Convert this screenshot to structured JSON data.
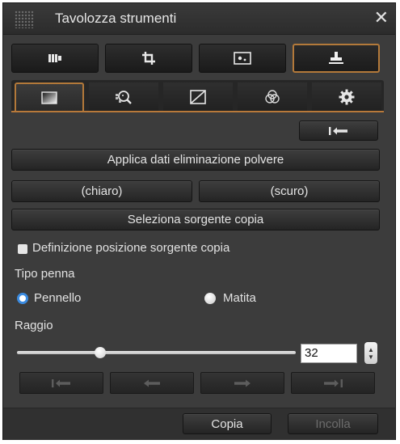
{
  "window": {
    "title": "Tavolozza strumenti"
  },
  "top_tabs": [
    {
      "name": "tab-adjust",
      "icon": "bars-icon",
      "active": false
    },
    {
      "name": "tab-crop",
      "icon": "crop-icon",
      "active": false
    },
    {
      "name": "tab-dust",
      "icon": "dust-icon",
      "active": false
    },
    {
      "name": "tab-stamp",
      "icon": "stamp-icon",
      "active": true
    }
  ],
  "sub_tabs": [
    {
      "icon": "gradient-icon",
      "active": true
    },
    {
      "icon": "magnify-grid-icon",
      "active": false
    },
    {
      "icon": "curve-icon",
      "active": false
    },
    {
      "icon": "color-circles-icon",
      "active": false
    },
    {
      "icon": "gear-icon",
      "active": false
    }
  ],
  "buttons": {
    "apply_dust": "Applica dati eliminazione polvere",
    "light": "(chiaro)",
    "dark": "(scuro)",
    "select_source": "Seleziona sorgente copia",
    "copy": "Copia",
    "paste": "Incolla"
  },
  "checkbox": {
    "label": "Definizione posizione sorgente copia",
    "checked": false
  },
  "pen_type": {
    "label": "Tipo penna",
    "options": [
      {
        "label": "Pennello",
        "selected": true
      },
      {
        "label": "Matita",
        "selected": false
      }
    ]
  },
  "radius": {
    "label": "Raggio",
    "value": "32",
    "slider_fraction": 0.3
  },
  "history_buttons": [
    "undo-all-icon",
    "undo-icon",
    "redo-icon",
    "redo-all-icon"
  ],
  "colors": {
    "accent": "#b3793a",
    "panel": "#3c3c3c",
    "radio_selected": "#3b8be0"
  }
}
